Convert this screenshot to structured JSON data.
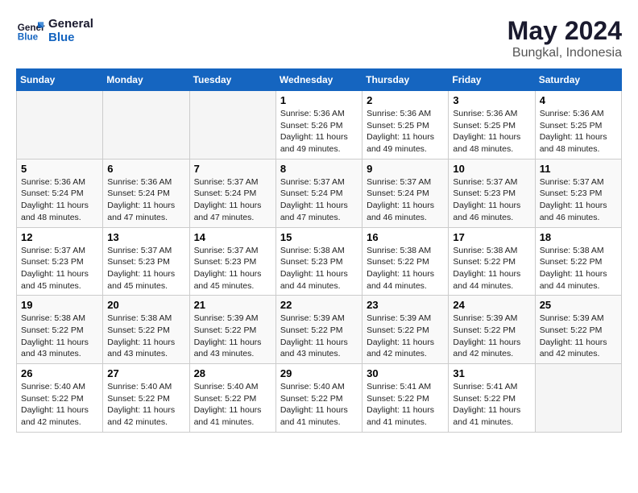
{
  "header": {
    "logo_line1": "General",
    "logo_line2": "Blue",
    "month": "May 2024",
    "location": "Bungkal, Indonesia"
  },
  "days_of_week": [
    "Sunday",
    "Monday",
    "Tuesday",
    "Wednesday",
    "Thursday",
    "Friday",
    "Saturday"
  ],
  "weeks": [
    [
      {
        "day": "",
        "info": ""
      },
      {
        "day": "",
        "info": ""
      },
      {
        "day": "",
        "info": ""
      },
      {
        "day": "1",
        "info": "Sunrise: 5:36 AM\nSunset: 5:26 PM\nDaylight: 11 hours\nand 49 minutes."
      },
      {
        "day": "2",
        "info": "Sunrise: 5:36 AM\nSunset: 5:25 PM\nDaylight: 11 hours\nand 49 minutes."
      },
      {
        "day": "3",
        "info": "Sunrise: 5:36 AM\nSunset: 5:25 PM\nDaylight: 11 hours\nand 48 minutes."
      },
      {
        "day": "4",
        "info": "Sunrise: 5:36 AM\nSunset: 5:25 PM\nDaylight: 11 hours\nand 48 minutes."
      }
    ],
    [
      {
        "day": "5",
        "info": "Sunrise: 5:36 AM\nSunset: 5:24 PM\nDaylight: 11 hours\nand 48 minutes."
      },
      {
        "day": "6",
        "info": "Sunrise: 5:36 AM\nSunset: 5:24 PM\nDaylight: 11 hours\nand 47 minutes."
      },
      {
        "day": "7",
        "info": "Sunrise: 5:37 AM\nSunset: 5:24 PM\nDaylight: 11 hours\nand 47 minutes."
      },
      {
        "day": "8",
        "info": "Sunrise: 5:37 AM\nSunset: 5:24 PM\nDaylight: 11 hours\nand 47 minutes."
      },
      {
        "day": "9",
        "info": "Sunrise: 5:37 AM\nSunset: 5:24 PM\nDaylight: 11 hours\nand 46 minutes."
      },
      {
        "day": "10",
        "info": "Sunrise: 5:37 AM\nSunset: 5:23 PM\nDaylight: 11 hours\nand 46 minutes."
      },
      {
        "day": "11",
        "info": "Sunrise: 5:37 AM\nSunset: 5:23 PM\nDaylight: 11 hours\nand 46 minutes."
      }
    ],
    [
      {
        "day": "12",
        "info": "Sunrise: 5:37 AM\nSunset: 5:23 PM\nDaylight: 11 hours\nand 45 minutes."
      },
      {
        "day": "13",
        "info": "Sunrise: 5:37 AM\nSunset: 5:23 PM\nDaylight: 11 hours\nand 45 minutes."
      },
      {
        "day": "14",
        "info": "Sunrise: 5:37 AM\nSunset: 5:23 PM\nDaylight: 11 hours\nand 45 minutes."
      },
      {
        "day": "15",
        "info": "Sunrise: 5:38 AM\nSunset: 5:23 PM\nDaylight: 11 hours\nand 44 minutes."
      },
      {
        "day": "16",
        "info": "Sunrise: 5:38 AM\nSunset: 5:22 PM\nDaylight: 11 hours\nand 44 minutes."
      },
      {
        "day": "17",
        "info": "Sunrise: 5:38 AM\nSunset: 5:22 PM\nDaylight: 11 hours\nand 44 minutes."
      },
      {
        "day": "18",
        "info": "Sunrise: 5:38 AM\nSunset: 5:22 PM\nDaylight: 11 hours\nand 44 minutes."
      }
    ],
    [
      {
        "day": "19",
        "info": "Sunrise: 5:38 AM\nSunset: 5:22 PM\nDaylight: 11 hours\nand 43 minutes."
      },
      {
        "day": "20",
        "info": "Sunrise: 5:38 AM\nSunset: 5:22 PM\nDaylight: 11 hours\nand 43 minutes."
      },
      {
        "day": "21",
        "info": "Sunrise: 5:39 AM\nSunset: 5:22 PM\nDaylight: 11 hours\nand 43 minutes."
      },
      {
        "day": "22",
        "info": "Sunrise: 5:39 AM\nSunset: 5:22 PM\nDaylight: 11 hours\nand 43 minutes."
      },
      {
        "day": "23",
        "info": "Sunrise: 5:39 AM\nSunset: 5:22 PM\nDaylight: 11 hours\nand 42 minutes."
      },
      {
        "day": "24",
        "info": "Sunrise: 5:39 AM\nSunset: 5:22 PM\nDaylight: 11 hours\nand 42 minutes."
      },
      {
        "day": "25",
        "info": "Sunrise: 5:39 AM\nSunset: 5:22 PM\nDaylight: 11 hours\nand 42 minutes."
      }
    ],
    [
      {
        "day": "26",
        "info": "Sunrise: 5:40 AM\nSunset: 5:22 PM\nDaylight: 11 hours\nand 42 minutes."
      },
      {
        "day": "27",
        "info": "Sunrise: 5:40 AM\nSunset: 5:22 PM\nDaylight: 11 hours\nand 42 minutes."
      },
      {
        "day": "28",
        "info": "Sunrise: 5:40 AM\nSunset: 5:22 PM\nDaylight: 11 hours\nand 41 minutes."
      },
      {
        "day": "29",
        "info": "Sunrise: 5:40 AM\nSunset: 5:22 PM\nDaylight: 11 hours\nand 41 minutes."
      },
      {
        "day": "30",
        "info": "Sunrise: 5:41 AM\nSunset: 5:22 PM\nDaylight: 11 hours\nand 41 minutes."
      },
      {
        "day": "31",
        "info": "Sunrise: 5:41 AM\nSunset: 5:22 PM\nDaylight: 11 hours\nand 41 minutes."
      },
      {
        "day": "",
        "info": ""
      }
    ]
  ]
}
